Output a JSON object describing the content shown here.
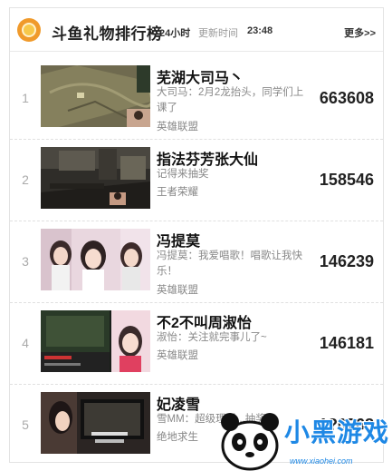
{
  "header": {
    "title": "斗鱼礼物排行榜",
    "period": "24小时",
    "update_label": "更新时间",
    "update_time": "23:48",
    "more_label": "更多>>"
  },
  "entries": [
    {
      "rank": "1",
      "name": "芜湖大司马丶",
      "desc": "大司马：2月2龙抬头，同学们上课了",
      "game": "英雄联盟",
      "count": "663608"
    },
    {
      "rank": "2",
      "name": "指法芬芳张大仙",
      "desc": "记得来抽奖",
      "game": "王者荣耀",
      "count": "158546"
    },
    {
      "rank": "3",
      "name": "冯提莫",
      "desc": "冯提莫：我爱唱歌！唱歌让我快乐！",
      "game": "英雄联盟",
      "count": "146239"
    },
    {
      "rank": "4",
      "name": "不2不叫周淑怡",
      "desc": "淑怡：关注就完事儿了~",
      "game": "英雄联盟",
      "count": "146181"
    },
    {
      "rank": "5",
      "name": "妃凌雪",
      "desc": "雪MM：超级理财...抽奖",
      "game": "绝地求生",
      "count": "1?0768"
    }
  ],
  "watermark": {
    "brand": "小黑游戏",
    "url": "www.xiaohei.com"
  },
  "colors": {
    "accent": "#f09a2b",
    "watermark": "#1e88e5",
    "rank": "#aaaaaa"
  }
}
